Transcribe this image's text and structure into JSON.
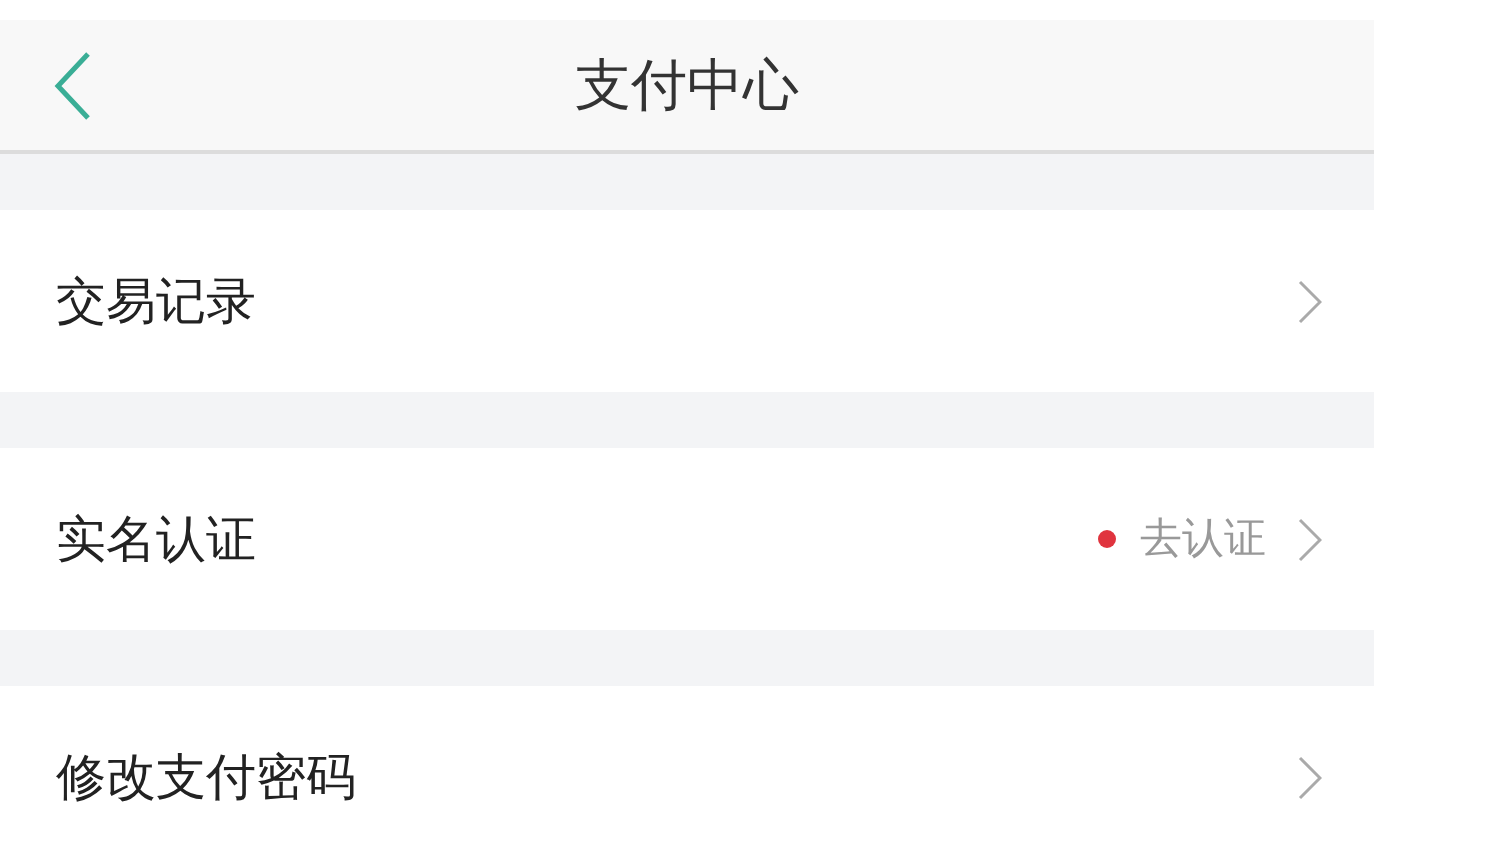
{
  "header": {
    "title": "支付中心"
  },
  "rows": [
    {
      "label": "交易记录",
      "alert": false
    },
    {
      "label": "实名认证",
      "status": "去认证",
      "alert": true
    },
    {
      "label": "修改支付密码",
      "alert": false
    }
  ]
}
